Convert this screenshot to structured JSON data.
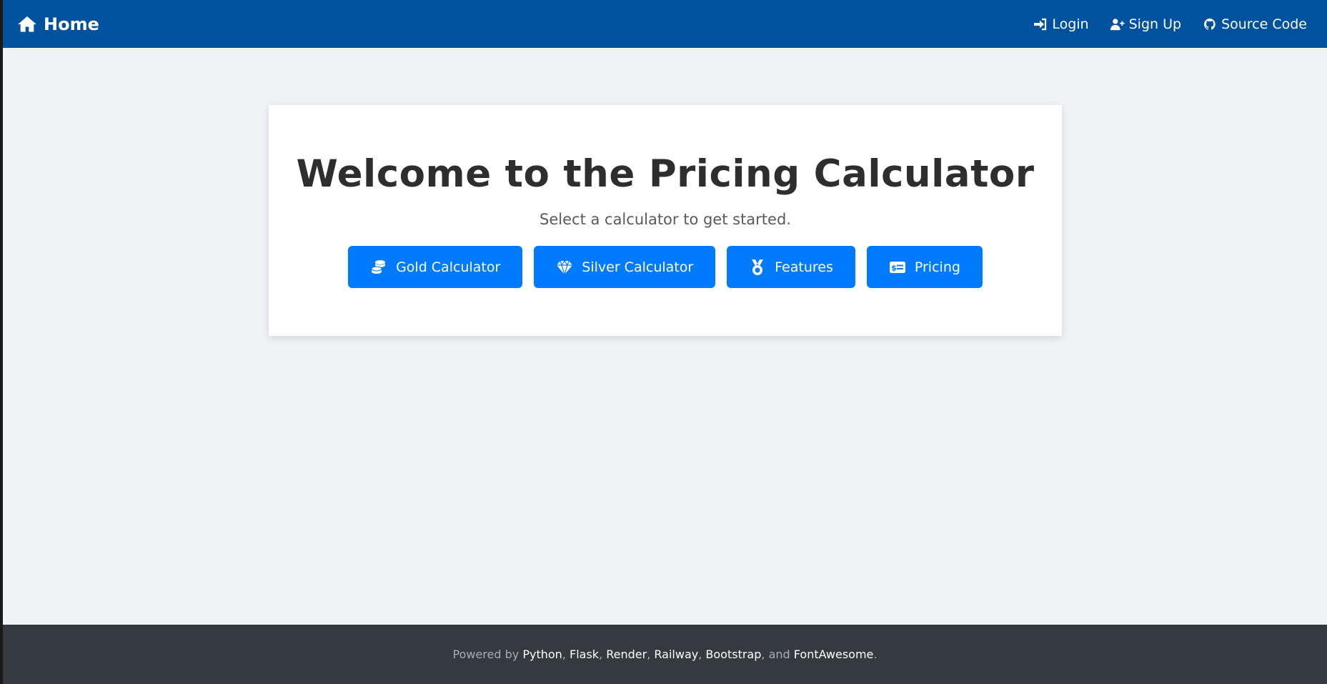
{
  "navbar": {
    "brand_label": "Home",
    "links": [
      {
        "label": "Login",
        "icon": "sign-in-icon"
      },
      {
        "label": "Sign Up",
        "icon": "user-plus-icon"
      },
      {
        "label": "Source Code",
        "icon": "github-icon"
      }
    ]
  },
  "main": {
    "title": "Welcome to the Pricing Calculator",
    "subtitle": "Select a calculator to get started.",
    "buttons": [
      {
        "label": "Gold Calculator",
        "icon": "coins-icon"
      },
      {
        "label": "Silver Calculator",
        "icon": "gem-icon"
      },
      {
        "label": "Features",
        "icon": "medal-icon"
      },
      {
        "label": "Pricing",
        "icon": "money-check-icon"
      }
    ]
  },
  "footer": {
    "prefix": "Powered by",
    "links": [
      "Python",
      "Flask",
      "Render",
      "Railway",
      "Bootstrap",
      "FontAwesome"
    ],
    "comma": ",",
    "and": "and",
    "period": "."
  },
  "colors": {
    "navbar": "#00519e",
    "button": "#007bff",
    "footer": "#343a40",
    "background": "#f0f2f5"
  }
}
